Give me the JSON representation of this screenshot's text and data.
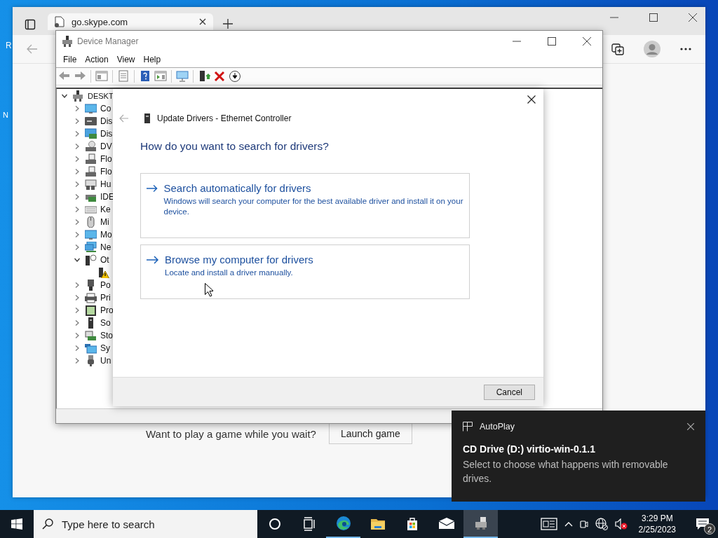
{
  "desktop": {
    "icon_labels": [
      "R",
      "N"
    ]
  },
  "browser": {
    "tabs": [
      {
        "title": "go.skype.com",
        "selected": true
      }
    ],
    "content": {
      "prompt": "Want to play a game while you wait?",
      "button": "Launch game"
    }
  },
  "device_manager": {
    "title": "Device Manager",
    "menu": [
      "File",
      "Action",
      "View",
      "Help"
    ],
    "tree": {
      "label": "DESKT",
      "kind": "computer",
      "expanded": true,
      "children": [
        {
          "label": "Co",
          "kind": "monitor",
          "expanded": false
        },
        {
          "label": "Dis",
          "kind": "disk",
          "expanded": false
        },
        {
          "label": "Dis",
          "kind": "display",
          "expanded": false
        },
        {
          "label": "DV",
          "kind": "dvd",
          "expanded": false
        },
        {
          "label": "Flo",
          "kind": "floppy",
          "expanded": false
        },
        {
          "label": "Flo",
          "kind": "floppy",
          "expanded": false
        },
        {
          "label": "Hu",
          "kind": "hid",
          "expanded": false
        },
        {
          "label": "IDE",
          "kind": "card",
          "expanded": false
        },
        {
          "label": "Ke",
          "kind": "keyboard",
          "expanded": false
        },
        {
          "label": "Mi",
          "kind": "mouse",
          "expanded": false
        },
        {
          "label": "Mo",
          "kind": "monitor",
          "expanded": false
        },
        {
          "label": "Ne",
          "kind": "network",
          "expanded": false
        },
        {
          "label": "Ot",
          "kind": "other",
          "expanded": true,
          "children": [
            {
              "kind": "warning"
            }
          ]
        },
        {
          "label": "Po",
          "kind": "port",
          "expanded": false
        },
        {
          "label": "Pri",
          "kind": "printer",
          "expanded": false
        },
        {
          "label": "Pro",
          "kind": "processor",
          "expanded": false
        },
        {
          "label": "So",
          "kind": "software",
          "expanded": false
        },
        {
          "label": "Sto",
          "kind": "storage",
          "expanded": false
        },
        {
          "label": "Sy",
          "kind": "system",
          "expanded": false
        },
        {
          "label": "Un",
          "kind": "usb",
          "expanded": false
        }
      ]
    }
  },
  "dialog": {
    "title": "Update Drivers - Ethernet Controller",
    "heading": "How do you want to search for drivers?",
    "options": [
      {
        "title": "Search automatically for drivers",
        "description": "Windows will search your computer for the best available driver and install it on your device."
      },
      {
        "title": "Browse my computer for drivers",
        "description": "Locate and install a driver manually."
      }
    ],
    "cancel": "Cancel"
  },
  "notification": {
    "app": "AutoPlay",
    "title": "CD Drive (D:) virtio-win-0.1.1",
    "body": "Select to choose what happens with removable drives."
  },
  "taskbar": {
    "search_placeholder": "Type here to search",
    "apps": [
      {
        "kind": "cortana",
        "running": false,
        "selected": false
      },
      {
        "kind": "task-view",
        "running": false,
        "selected": false
      },
      {
        "kind": "edge",
        "running": true,
        "selected": false
      },
      {
        "kind": "explorer",
        "running": false,
        "selected": false
      },
      {
        "kind": "store",
        "running": false,
        "selected": false
      },
      {
        "kind": "mail",
        "running": false,
        "selected": false
      },
      {
        "kind": "device-manager",
        "running": true,
        "selected": true
      }
    ],
    "time": "3:29 PM",
    "date": "2/25/2023",
    "notification_count": "2"
  }
}
